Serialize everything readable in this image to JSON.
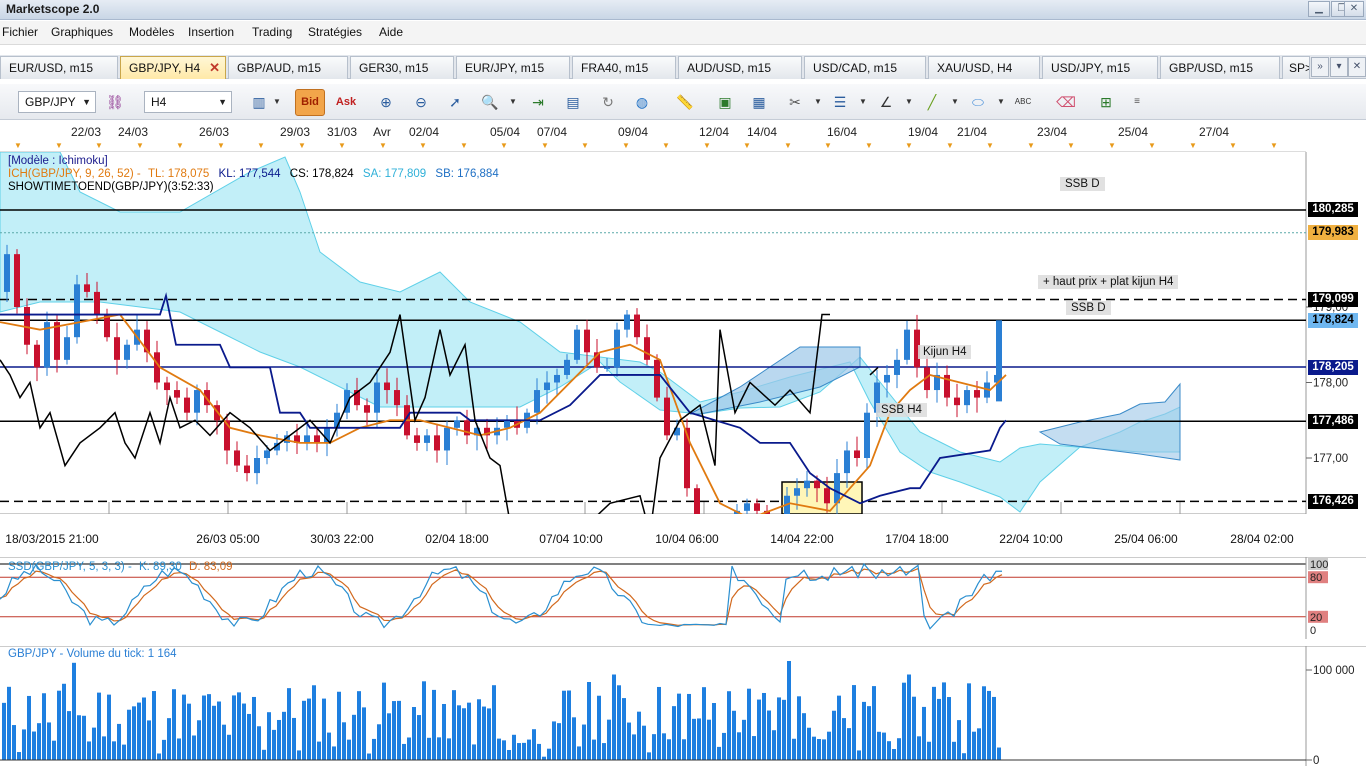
{
  "window": {
    "title": "Marketscope 2.0"
  },
  "menu": [
    "Fichier",
    "Graphiques",
    "Modèles",
    "Insertion",
    "Trading",
    "Stratégies",
    "Aide"
  ],
  "tabs": [
    {
      "label": "EUR/USD, m15",
      "active": false
    },
    {
      "label": "GBP/JPY, H4",
      "active": true
    },
    {
      "label": "GBP/AUD, m15",
      "active": false
    },
    {
      "label": "GER30, m15",
      "active": false
    },
    {
      "label": "EUR/JPY, m15",
      "active": false
    },
    {
      "label": "FRA40, m15",
      "active": false
    },
    {
      "label": "AUD/USD, m15",
      "active": false
    },
    {
      "label": "USD/CAD, m15",
      "active": false
    },
    {
      "label": "XAU/USD, H4",
      "active": false
    },
    {
      "label": "USD/JPY, m15",
      "active": false
    },
    {
      "label": "GBP/USD, m15",
      "active": false
    },
    {
      "label": "SP>",
      "active": false
    }
  ],
  "toolbar": {
    "symbol": "GBP/JPY",
    "timeframe": "H4",
    "bid_label": "Bid",
    "ask_label": "Ask",
    "icons": [
      "bar-chart-icon",
      "crosshair-icon",
      "zoom-in-icon",
      "zoom-out-icon",
      "cursor-icon",
      "magnifier-icon",
      "align-icon",
      "properties-icon",
      "refresh-icon",
      "globe-icon",
      "ruler-icon",
      "image-icon",
      "template-icon",
      "tools-icon",
      "lines-icon",
      "trendline-icon",
      "pencil-icon",
      "ellipse-icon",
      "text-icon",
      "eraser-icon",
      "network-icon",
      "more-icon"
    ]
  },
  "top_dates": [
    "22/03",
    "24/03",
    "26/03",
    "29/03",
    "31/03",
    "Avr",
    "02/04",
    "05/04",
    "07/04",
    "09/04",
    "12/04",
    "14/04",
    "16/04",
    "19/04",
    "21/04",
    "23/04",
    "25/04",
    "27/04"
  ],
  "legend": {
    "model": "[Modèle : Ichimoku]",
    "ich": "ICH(GBP/JPY, 9, 26, 52) -",
    "tl": "TL: 178,075",
    "kl": "KL: 177,544",
    "cs": "CS: 178,824",
    "sa": "SA: 177,809",
    "sb": "SB: 176,884",
    "showtime": "SHOWTIMETOEND(GBP/JPY)(3:52:33)"
  },
  "price_axis": {
    "ticks": [
      "179,00",
      "178,00",
      "177,00"
    ],
    "labels": [
      {
        "value": "180,285",
        "bg": "#000000",
        "fg": "#ffffff"
      },
      {
        "value": "179,983",
        "bg": "#f0b040",
        "fg": "#000000"
      },
      {
        "value": "179,099",
        "bg": "#000000",
        "fg": "#ffffff"
      },
      {
        "value": "178,824",
        "bg": "#6fb7f0",
        "fg": "#000000"
      },
      {
        "value": "178,205",
        "bg": "#0a1a8c",
        "fg": "#ffffff"
      },
      {
        "value": "177,486",
        "bg": "#000000",
        "fg": "#ffffff"
      },
      {
        "value": "176,426",
        "bg": "#000000",
        "fg": "#ffffff"
      }
    ]
  },
  "notes": {
    "ssb_d_top": "SSB D",
    "haut_prix": "+ haut prix + plat kijun H4",
    "ssb_d": "SSB D",
    "kijun_h4": "Kijun H4",
    "ssb_h4": "SSB H4"
  },
  "time_axis": [
    "18/03/2015 21:00",
    "26/03 05:00",
    "30/03 22:00",
    "02/04 18:00",
    "07/04 10:00",
    "10/04 06:00",
    "14/04 22:00",
    "17/04 18:00",
    "22/04 10:00",
    "25/04 06:00",
    "28/04 02:00"
  ],
  "stochastic": {
    "title": "SSD(GBP/JPY, 5, 3, 3) -",
    "k": "K: 89,30",
    "d": "D: 83,09",
    "levels": [
      "100",
      "80",
      "20",
      "0"
    ],
    "colors": {
      "k": "#2a8fd0",
      "d": "#d2691e"
    }
  },
  "volume": {
    "title": "GBP/JPY - Volume du tick: 1 164",
    "axis": [
      "100 000",
      "0"
    ]
  },
  "colors": {
    "tenkan": "#e07a10",
    "kijun": "#0a1a8c",
    "chikou": "#000000",
    "bull": "#2a7fd4",
    "bear": "#c8102e",
    "cloud": "#aee9f5"
  }
}
